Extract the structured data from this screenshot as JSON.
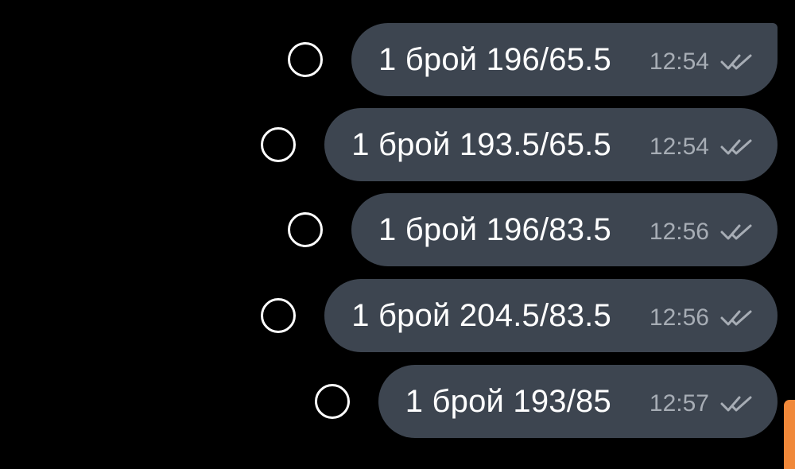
{
  "messages": [
    {
      "text": "1 брой 196/65.5",
      "time": "12:54",
      "status_icon": "double-check-icon"
    },
    {
      "text": "1 брой 193.5/65.5",
      "time": "12:54",
      "status_icon": "double-check-icon"
    },
    {
      "text": "1 брой 196/83.5",
      "time": "12:56",
      "status_icon": "double-check-icon"
    },
    {
      "text": "1 брой 204.5/83.5",
      "time": "12:56",
      "status_icon": "double-check-icon"
    },
    {
      "text": "1 брой 193/85",
      "time": "12:57",
      "status_icon": "double-check-icon"
    }
  ],
  "colors": {
    "background": "#000000",
    "bubble": "#3d4550",
    "text": "#ffffff",
    "meta": "#a7adb5",
    "scroll_accent": "#f0883a"
  }
}
